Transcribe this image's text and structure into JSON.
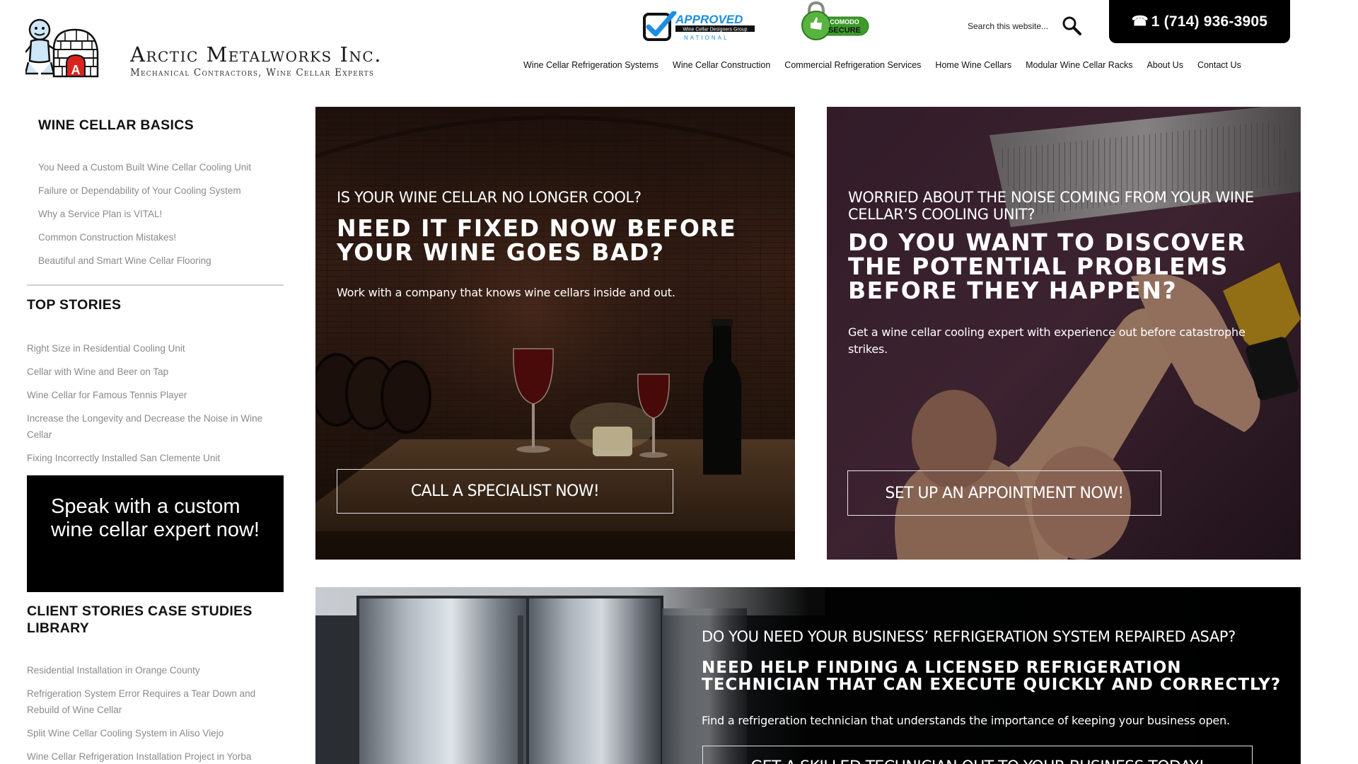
{
  "brand": {
    "name": "Arctic Metalworks Inc.",
    "tagline": "Mechanical Contractors, Wine Cellar Experts"
  },
  "badges": {
    "approved_title": "APPROVED",
    "approved_sub": "Wine Cellar Designers Group",
    "approved_national": "NATIONAL",
    "comodo_line1": "COMODO",
    "comodo_line2": "SECURE"
  },
  "search": {
    "placeholder": "Search this website..."
  },
  "phone": {
    "label": "1 (714) 936-3905"
  },
  "nav": {
    "items": [
      "Wine Cellar Refrigeration Systems",
      "Wine Cellar Construction",
      "Commercial Refrigeration Services",
      "Home Wine Cellars",
      "Modular Wine Cellar Racks",
      "About Us",
      "Contact Us"
    ]
  },
  "sidebar": {
    "basics": {
      "heading": "Wine Cellar Basics",
      "items": [
        "You Need a Custom Built Wine Cellar Cooling Unit",
        "Failure or Dependability of Your Cooling System",
        "Why a Service Plan is VITAL!",
        "Common Construction Mistakes!",
        "Beautiful and Smart Wine Cellar Flooring"
      ]
    },
    "top_stories": {
      "heading": "Top Stories",
      "items": [
        "Right Size in Residential Cooling Unit",
        "Cellar with Wine and Beer on Tap",
        "Wine Cellar for Famous Tennis Player",
        "Increase the Longevity and Decrease the Noise in Wine Cellar",
        "Fixing Incorrectly Installed San Clemente Unit"
      ]
    },
    "cta_text": "Speak with a custom wine cellar expert now!",
    "case_studies": {
      "heading": "Client Stories Case Studies Library",
      "items": [
        "Residential Installation in Orange County",
        "Refrigeration System Error Requires a Tear Down and Rebuild of Wine Cellar",
        "Split Wine Cellar Cooling System in Aliso Viejo",
        "Wine Cellar Refrigeration Installation Project in Yorba"
      ]
    }
  },
  "panels": {
    "p1": {
      "kicker": "Is your wine cellar no longer cool?",
      "headline": "Need it fixed now before your wine goes bad?",
      "lede": "Work with a company that knows wine cellars inside and out.",
      "cta": "Call a Specialist Now!"
    },
    "p2": {
      "kicker": "Worried about the noise coming from your wine cellar’s cooling unit?",
      "headline": "Do you want to discover the potential problems before they happen?",
      "lede": "Get a wine cellar cooling expert with experience out before catastrophe strikes.",
      "cta": "Set Up an Appointment Now!"
    },
    "p3": {
      "kicker": "Do you need your business’ refrigeration system repaired ASAP?",
      "headline": "Need help finding a licensed refrigeration technician that can execute quickly and correctly?",
      "lede": "Find a refrigeration technician that understands the importance of keeping your business open.",
      "cta": "Get a Skilled Technician Out to Your Business Today!"
    }
  }
}
